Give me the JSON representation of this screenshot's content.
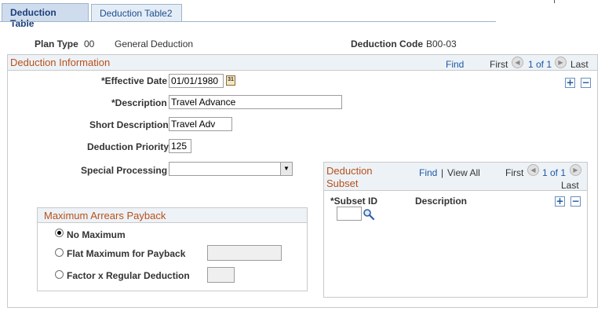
{
  "tabs": [
    {
      "label": "Deduction Table"
    },
    {
      "label": "Deduction Table2"
    }
  ],
  "header": {
    "plan_type_label": "Plan Type",
    "plan_type_code": "00",
    "plan_type_desc": "General Deduction",
    "deduction_code_label": "Deduction Code",
    "deduction_code_value": "B00-03"
  },
  "deduction_info": {
    "title": "Deduction Information",
    "find": "Find",
    "first": "First",
    "count": "1 of 1",
    "last": "Last",
    "effective_date_label": "*Effective Date",
    "effective_date_value": "01/01/1980",
    "description_label": "*Description",
    "description_value": "Travel Advance",
    "short_description_label": "Short Description",
    "short_description_value": "Travel Adv",
    "priority_label": "Deduction Priority",
    "priority_value": "125",
    "special_processing_label": "Special Processing",
    "special_processing_value": ""
  },
  "arrears": {
    "title": "Maximum Arrears Payback",
    "options": [
      {
        "label": "No Maximum",
        "selected": true
      },
      {
        "label": "Flat Maximum for Payback",
        "selected": false
      },
      {
        "label": "Factor x Regular Deduction",
        "selected": false
      }
    ]
  },
  "subset": {
    "title_line1": "Deduction",
    "title_line2": "Subset",
    "find": "Find",
    "separator": "|",
    "view_all": "View All",
    "first": "First",
    "count": "1 of 1",
    "last": "Last",
    "col_subset_id": "*Subset ID",
    "col_description": "Description",
    "subset_id_value": ""
  },
  "icons": {
    "calendar": "calendar-icon",
    "lookup": "lookup-icon",
    "add": "add-row-icon",
    "delete": "delete-row-icon",
    "prev": "previous-icon",
    "next": "next-icon"
  }
}
